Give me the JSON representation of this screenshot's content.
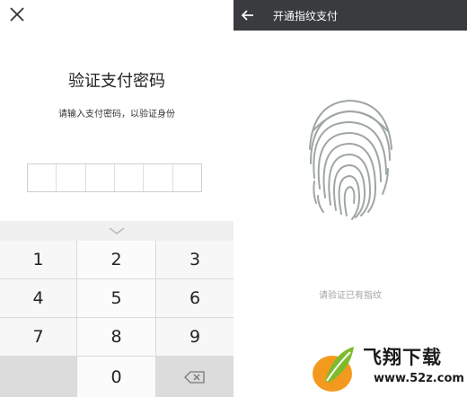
{
  "password_screen": {
    "title": "验证支付密码",
    "subtitle": "请输入支付密码，以验证身份",
    "pin_length": 6
  },
  "keyboard": {
    "rows": [
      [
        "1",
        "2",
        "3"
      ],
      [
        "4",
        "5",
        "6"
      ],
      [
        "7",
        "8",
        "9"
      ],
      [
        "",
        "0",
        ""
      ]
    ],
    "icons": {
      "collapse": "chevron-down-icon",
      "delete": "backspace-icon"
    }
  },
  "fingerprint_screen": {
    "title": "开通指纹支付",
    "hint": "请验证已有指纹",
    "icons": {
      "back": "arrow-left-icon",
      "fingerprint": "fingerprint-icon"
    }
  },
  "watermark": {
    "title": "飞翔下载",
    "url": "www.52z.com"
  },
  "colors": {
    "topbar": "#393b3f",
    "fingerprint": "#9fa6a4",
    "keyboard_bg": "#f0f0f0",
    "logo_orange": "#f39a1e",
    "logo_green": "#7dbb2c"
  }
}
